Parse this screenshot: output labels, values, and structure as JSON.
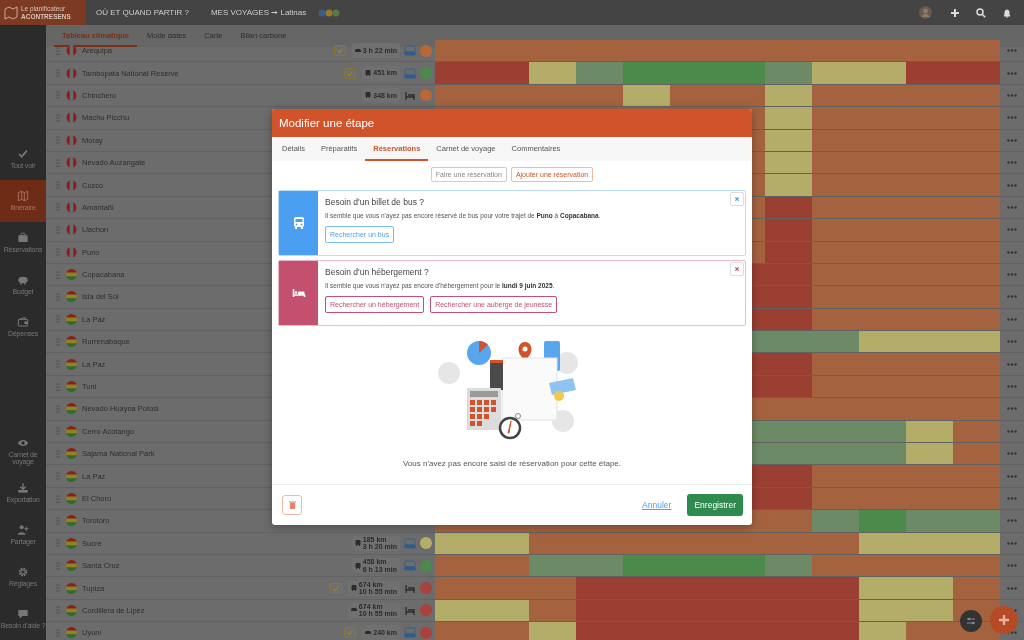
{
  "header": {
    "logo_top": "Le planificateur",
    "logo_bottom": "ACONTRESENS",
    "nav": [
      {
        "label": "OÙ ET QUAND PARTIR ?"
      },
      {
        "label": "MES VOYAGES ➞ Latinas"
      }
    ]
  },
  "sidebar": {
    "top": [
      {
        "label": "Tout voir",
        "selected": false
      },
      {
        "label": "Itinéraire",
        "selected": true
      },
      {
        "label": "Réservations",
        "selected": false
      },
      {
        "label": "Budget",
        "selected": false
      },
      {
        "label": "Dépenses",
        "selected": false
      }
    ],
    "bottom": [
      {
        "label": "Carnet de voyage",
        "selected": false
      },
      {
        "label": "Exportation",
        "selected": false
      },
      {
        "label": "Partager",
        "selected": false
      },
      {
        "label": "Réglages",
        "selected": false
      },
      {
        "label": "Besoin d'aide ?",
        "selected": false
      }
    ]
  },
  "view_tabs": [
    {
      "label": "Tableau climatique",
      "selected": true
    },
    {
      "label": "Mode dates",
      "selected": false
    },
    {
      "label": "Carte",
      "selected": false
    },
    {
      "label": "Bilan carbone",
      "selected": false
    }
  ],
  "stages": [
    {
      "name": "Arequipa",
      "flag": {
        "kind": "peru"
      },
      "booked": true,
      "transport": {
        "kind": "car",
        "lines": [
          "3 h 22 min"
        ]
      },
      "lodging": {
        "kind": "nights"
      },
      "score": {
        "color": "#b8663a"
      },
      "climate": [
        {
          "color": "#a5623f"
        },
        {
          "color": "#a5623f"
        },
        {
          "color": "#a5623f"
        },
        {
          "color": "#a5623f"
        },
        {
          "color": "#a5623f"
        },
        {
          "color": "#a5623f"
        },
        {
          "color": "#a5623f"
        },
        {
          "color": "#a5623f"
        },
        {
          "color": "#a5623f"
        },
        {
          "color": "#a5623f"
        },
        {
          "color": "#a5623f"
        },
        {
          "color": "#a5623f"
        }
      ]
    },
    {
      "name": "Tambopata National Reserve",
      "flag": {
        "kind": "peru"
      },
      "booked": true,
      "transport": {
        "kind": "bus",
        "lines": [
          "451 km"
        ]
      },
      "lodging": {
        "kind": "nights"
      },
      "score": {
        "color": "#4b8a4b"
      },
      "climate": [
        {
          "color": "#9c3f33"
        },
        {
          "color": "#9c3f33"
        },
        {
          "color": "#b4ad6a"
        },
        {
          "color": "#6d8a66"
        },
        {
          "color": "#4b8a4b"
        },
        {
          "color": "#4b8a4b"
        },
        {
          "color": "#4b8a4b"
        },
        {
          "color": "#6d8a66"
        },
        {
          "color": "#b4ad6a"
        },
        {
          "color": "#b4ad6a"
        },
        {
          "color": "#9c3f33"
        },
        {
          "color": "#9c3f33"
        }
      ]
    },
    {
      "name": "Chinchero",
      "flag": {
        "kind": "peru"
      },
      "booked": false,
      "transport": {
        "kind": "bus",
        "lines": [
          "348 km"
        ]
      },
      "lodging": {
        "kind": "bed"
      },
      "score": {
        "color": "#b8663a"
      },
      "climate": [
        {
          "color": "#a5623f"
        },
        {
          "color": "#a5623f"
        },
        {
          "color": "#a5623f"
        },
        {
          "color": "#a5623f"
        },
        {
          "color": "#b4ad6a"
        },
        {
          "color": "#a5623f"
        },
        {
          "color": "#a5623f"
        },
        {
          "color": "#b4ad6a"
        },
        {
          "color": "#a5623f"
        },
        {
          "color": "#a5623f"
        },
        {
          "color": "#a5623f"
        },
        {
          "color": "#a5623f"
        }
      ]
    },
    {
      "name": "Machu Picchu",
      "flag": {
        "kind": "peru"
      },
      "booked": false,
      "climate": [
        {
          "color": "#a5623f"
        },
        {
          "color": "#a5623f"
        },
        {
          "color": "#a5623f"
        },
        {
          "color": "#a5623f"
        },
        {
          "color": "#a5623f"
        },
        {
          "color": "#a5623f"
        },
        {
          "color": "#a5623f"
        },
        {
          "color": "#b4ad6a"
        },
        {
          "color": "#a5623f"
        },
        {
          "color": "#a5623f"
        },
        {
          "color": "#a5623f"
        },
        {
          "color": "#a5623f"
        }
      ]
    },
    {
      "name": "Moray",
      "flag": {
        "kind": "peru"
      },
      "booked": false,
      "climate": [
        {
          "color": "#a5623f"
        },
        {
          "color": "#b4ad6a"
        },
        {
          "color": "#a5623f"
        },
        {
          "color": "#a5623f"
        },
        {
          "color": "#a5623f"
        },
        {
          "color": "#a5623f"
        }
      ]
    },
    {
      "name": "Nevado Auzangate",
      "flag": {
        "kind": "peru"
      },
      "booked": false,
      "climate": [
        {
          "color": "#a5623f"
        },
        {
          "color": "#b4ad6a"
        },
        {
          "color": "#a5623f"
        },
        {
          "color": "#a5623f"
        },
        {
          "color": "#a5623f"
        },
        {
          "color": "#a5623f"
        }
      ]
    },
    {
      "name": "Cuzco",
      "flag": {
        "kind": "peru"
      },
      "booked": false,
      "climate": [
        {
          "color": "#a5623f"
        },
        {
          "color": "#b4ad6a"
        },
        {
          "color": "#a5623f"
        },
        {
          "color": "#a5623f"
        },
        {
          "color": "#a5623f"
        },
        {
          "color": "#a5623f"
        }
      ]
    },
    {
      "name": "Amantañi",
      "flag": {
        "kind": "peru"
      },
      "booked": false,
      "climate": [
        {
          "color": "#a5623f"
        },
        {
          "color": "#9c3f33"
        },
        {
          "color": "#a5623f"
        },
        {
          "color": "#a5623f"
        },
        {
          "color": "#a5623f"
        },
        {
          "color": "#a5623f"
        }
      ]
    },
    {
      "name": "Llachon",
      "flag": {
        "kind": "peru"
      },
      "booked": false,
      "climate": [
        {
          "color": "#a5623f"
        },
        {
          "color": "#9c3f33"
        },
        {
          "color": "#a5623f"
        },
        {
          "color": "#a5623f"
        },
        {
          "color": "#a5623f"
        },
        {
          "color": "#a5623f"
        }
      ]
    },
    {
      "name": "Puno",
      "flag": {
        "kind": "peru"
      },
      "booked": false,
      "climate": [
        {
          "color": "#a5623f"
        },
        {
          "color": "#9c3f33"
        },
        {
          "color": "#a5623f"
        },
        {
          "color": "#a5623f"
        },
        {
          "color": "#a5623f"
        },
        {
          "color": "#a5623f"
        }
      ]
    },
    {
      "name": "Copacabana",
      "flag": {
        "kind": "bolivia"
      },
      "booked": false,
      "climate": [
        {
          "color": "#9c3f33"
        },
        {
          "color": "#9c3f33"
        },
        {
          "color": "#a5623f"
        },
        {
          "color": "#a5623f"
        },
        {
          "color": "#a5623f"
        },
        {
          "color": "#a5623f"
        }
      ]
    },
    {
      "name": "Isla del Sol",
      "flag": {
        "kind": "bolivia"
      },
      "booked": false,
      "climate": [
        {
          "color": "#9c3f33"
        },
        {
          "color": "#9c3f33"
        },
        {
          "color": "#a5623f"
        },
        {
          "color": "#a5623f"
        },
        {
          "color": "#a5623f"
        },
        {
          "color": "#a5623f"
        }
      ]
    },
    {
      "name": "La Paz",
      "flag": {
        "kind": "bolivia"
      },
      "booked": false,
      "climate": [
        {
          "color": "#9c3f33"
        },
        {
          "color": "#9c3f33"
        },
        {
          "color": "#a5623f"
        },
        {
          "color": "#a5623f"
        },
        {
          "color": "#a5623f"
        },
        {
          "color": "#a5623f"
        }
      ]
    },
    {
      "name": "Rurrenabaque",
      "flag": {
        "kind": "bolivia"
      },
      "booked": false,
      "climate": [
        {
          "color": "#6d8a66"
        },
        {
          "color": "#6d8a66"
        },
        {
          "color": "#6d8a66"
        },
        {
          "color": "#b4ad6a"
        },
        {
          "color": "#b4ad6a"
        },
        {
          "color": "#b4ad6a"
        }
      ]
    },
    {
      "name": "La Paz",
      "flag": {
        "kind": "bolivia"
      },
      "booked": false,
      "climate": [
        {
          "color": "#9c3f33"
        },
        {
          "color": "#9c3f33"
        },
        {
          "color": "#a5623f"
        },
        {
          "color": "#a5623f"
        },
        {
          "color": "#a5623f"
        },
        {
          "color": "#a5623f"
        }
      ]
    },
    {
      "name": "Tuni",
      "flag": {
        "kind": "bolivia"
      },
      "booked": false,
      "climate": [
        {
          "color": "#9c3f33"
        },
        {
          "color": "#9c3f33"
        },
        {
          "color": "#a5623f"
        },
        {
          "color": "#a5623f"
        },
        {
          "color": "#a5623f"
        },
        {
          "color": "#a5623f"
        }
      ]
    },
    {
      "name": "Nevado Huayna Potosi",
      "flag": {
        "kind": "bolivia"
      },
      "booked": false,
      "climate": [
        {
          "color": "#a5623f"
        },
        {
          "color": "#a5623f"
        },
        {
          "color": "#a5623f"
        },
        {
          "color": "#a5623f"
        },
        {
          "color": "#a5623f"
        },
        {
          "color": "#a5623f"
        }
      ]
    },
    {
      "name": "Cerro Acotango",
      "flag": {
        "kind": "bolivia"
      },
      "booked": false,
      "climate": [
        {
          "color": "#6d8a66"
        },
        {
          "color": "#6d8a66"
        },
        {
          "color": "#6d8a66"
        },
        {
          "color": "#6d8a66"
        },
        {
          "color": "#b4ad6a"
        },
        {
          "color": "#a5623f"
        }
      ]
    },
    {
      "name": "Sajama National Park",
      "flag": {
        "kind": "bolivia"
      },
      "booked": false,
      "climate": [
        {
          "color": "#6d8a66"
        },
        {
          "color": "#6d8a66"
        },
        {
          "color": "#6d8a66"
        },
        {
          "color": "#6d8a66"
        },
        {
          "color": "#b4ad6a"
        },
        {
          "color": "#a5623f"
        }
      ]
    },
    {
      "name": "La Paz",
      "flag": {
        "kind": "bolivia"
      },
      "booked": false,
      "climate": [
        {
          "color": "#9c3f33"
        },
        {
          "color": "#9c3f33"
        },
        {
          "color": "#a5623f"
        },
        {
          "color": "#a5623f"
        },
        {
          "color": "#a5623f"
        },
        {
          "color": "#a5623f"
        }
      ]
    },
    {
      "name": "El Choro",
      "flag": {
        "kind": "bolivia"
      },
      "booked": false,
      "climate": [
        {
          "color": "#9c3f33"
        },
        {
          "color": "#9c3f33"
        },
        {
          "color": "#a5623f"
        },
        {
          "color": "#a5623f"
        },
        {
          "color": "#a5623f"
        },
        {
          "color": "#a5623f"
        }
      ]
    },
    {
      "name": "Torotoro",
      "flag": {
        "kind": "bolivia"
      },
      "booked": false,
      "climate": [
        {
          "color": "#a5623f"
        },
        {
          "color": "#a5623f"
        },
        {
          "color": "#a5623f"
        },
        {
          "color": "#a5623f"
        },
        {
          "color": "#a5623f"
        },
        {
          "color": "#a5623f"
        },
        {
          "color": "#a5623f"
        },
        {
          "color": "#a5623f"
        },
        {
          "color": "#6d8a66"
        },
        {
          "color": "#4b8a4b"
        },
        {
          "color": "#6d8a66"
        },
        {
          "color": "#6d8a66"
        }
      ]
    },
    {
      "name": "Sucre",
      "flag": {
        "kind": "bolivia"
      },
      "booked": false,
      "transport": {
        "kind": "bus",
        "lines": [
          "185 km",
          "3 h 20 min"
        ]
      },
      "lodging": {
        "kind": "nights"
      },
      "score": {
        "color": "#b4ad6a"
      },
      "climate": [
        {
          "color": "#b4ad6a"
        },
        {
          "color": "#b4ad6a"
        },
        {
          "color": "#a5623f"
        },
        {
          "color": "#a5623f"
        },
        {
          "color": "#a5623f"
        },
        {
          "color": "#a5623f"
        },
        {
          "color": "#a5623f"
        },
        {
          "color": "#a5623f"
        },
        {
          "color": "#a5623f"
        },
        {
          "color": "#b4ad6a"
        },
        {
          "color": "#b4ad6a"
        },
        {
          "color": "#b4ad6a"
        }
      ]
    },
    {
      "name": "Santa Cruz",
      "flag": {
        "kind": "bolivia"
      },
      "booked": false,
      "transport": {
        "kind": "bus",
        "lines": [
          "458 km",
          "6 h 13 min"
        ]
      },
      "lodging": {
        "kind": "nights"
      },
      "score": {
        "color": "#4b8a4b"
      },
      "climate": [
        {
          "color": "#a5623f"
        },
        {
          "color": "#a5623f"
        },
        {
          "color": "#6d8a66"
        },
        {
          "color": "#6d8a66"
        },
        {
          "color": "#4b8a4b"
        },
        {
          "color": "#4b8a4b"
        },
        {
          "color": "#4b8a4b"
        },
        {
          "color": "#6d8a66"
        },
        {
          "color": "#a5623f"
        },
        {
          "color": "#a5623f"
        },
        {
          "color": "#a5623f"
        },
        {
          "color": "#a5623f"
        }
      ]
    },
    {
      "name": "Tupiza",
      "flag": {
        "kind": "bolivia"
      },
      "booked": true,
      "transport": {
        "kind": "bus",
        "lines": [
          "674 km",
          "10 h 55 min"
        ]
      },
      "lodging": {
        "kind": "bed"
      },
      "score": {
        "color": "#a8423a"
      },
      "climate": [
        {
          "color": "#a5623f"
        },
        {
          "color": "#a5623f"
        },
        {
          "color": "#a5623f"
        },
        {
          "color": "#9c3f33"
        },
        {
          "color": "#9c3f33"
        },
        {
          "color": "#9c3f33"
        },
        {
          "color": "#9c3f33"
        },
        {
          "color": "#9c3f33"
        },
        {
          "color": "#9c3f33"
        },
        {
          "color": "#b4ad6a"
        },
        {
          "color": "#b4ad6a"
        },
        {
          "color": "#a5623f"
        }
      ]
    },
    {
      "name": "Cordillera de Lipez",
      "flag": {
        "kind": "bolivia"
      },
      "booked": false,
      "transport": {
        "kind": "car",
        "lines": [
          "674 km",
          "10 h 55 min"
        ]
      },
      "lodging": {
        "kind": "bed"
      },
      "score": {
        "color": "#a8423a"
      },
      "climate": [
        {
          "color": "#b4ad6a"
        },
        {
          "color": "#b4ad6a"
        },
        {
          "color": "#a5623f"
        },
        {
          "color": "#9c3f33"
        },
        {
          "color": "#9c3f33"
        },
        {
          "color": "#9c3f33"
        },
        {
          "color": "#9c3f33"
        },
        {
          "color": "#9c3f33"
        },
        {
          "color": "#9c3f33"
        },
        {
          "color": "#b4ad6a"
        },
        {
          "color": "#b4ad6a"
        },
        {
          "color": "#a5623f"
        }
      ]
    },
    {
      "name": "Uyuni",
      "flag": {
        "kind": "bolivia"
      },
      "booked": true,
      "transport": {
        "kind": "car",
        "lines": [
          "240 km"
        ]
      },
      "lodging": {
        "kind": "nights"
      },
      "score": {
        "color": "#a8423a"
      },
      "climate": [
        {
          "color": "#a5623f"
        },
        {
          "color": "#a5623f"
        },
        {
          "color": "#b4ad6a"
        },
        {
          "color": "#9c3f33"
        },
        {
          "color": "#9c3f33"
        },
        {
          "color": "#9c3f33"
        },
        {
          "color": "#9c3f33"
        },
        {
          "color": "#9c3f33"
        },
        {
          "color": "#9c3f33"
        },
        {
          "color": "#b4ad6a"
        },
        {
          "color": "#a5623f"
        },
        {
          "color": "#a5623f"
        }
      ]
    }
  ],
  "modal": {
    "title": "Modifier une étape",
    "tabs": [
      {
        "label": "Détails",
        "selected": false
      },
      {
        "label": "Préparatifs",
        "selected": false
      },
      {
        "label": "Réservations",
        "selected": true
      },
      {
        "label": "Carnet de voyage",
        "selected": false
      },
      {
        "label": "Commentaires",
        "selected": false
      }
    ],
    "actions": [
      {
        "label": "Faire une réservation",
        "kind": "neutral"
      },
      {
        "label": "Ajouter une réservation",
        "kind": "accent"
      }
    ],
    "alerts": [
      {
        "kind": "bus",
        "title": "Besoin d'un billet de bus ?",
        "text": "Il semble que vous n'ayez pas encore réservé de bus pour votre trajet de **Puno** à **Copacabana**.",
        "buttons": [
          "Rechercher un bus"
        ]
      },
      {
        "kind": "lodging",
        "title": "Besoin d'un hébergement ?",
        "text": "Il semble que vous n'ayez pas encore d'hébergement pour le **lundi 9 juin 2025**.",
        "buttons": [
          "Rechercher un hébergement",
          "Rechercher une auberge de jeunesse"
        ]
      }
    ],
    "empty_text": "Vous n'avez pas encore saisi de réservation pour cette étape.",
    "cancel": "Annuler",
    "save": "Enregistrer"
  }
}
